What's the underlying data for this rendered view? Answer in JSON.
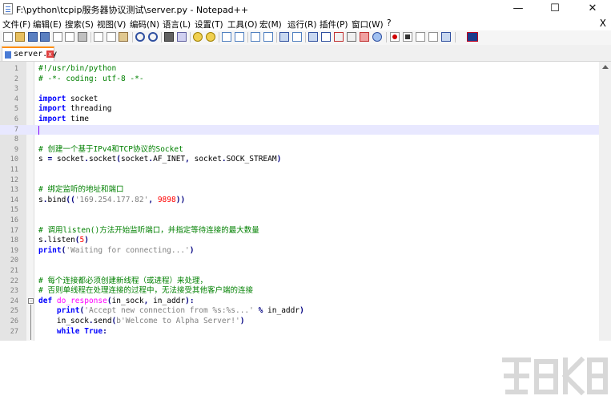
{
  "window": {
    "title": "F:\\python\\tcpip服务器协议测试\\server.py - Notepad++",
    "minimize_glyph": "—",
    "maximize_glyph": "☐",
    "close_glyph": "✕"
  },
  "menu": {
    "items": [
      "文件(F)",
      "编辑(E)",
      "搜索(S)",
      "视图(V)",
      "编码(N)",
      "语言(L)",
      "设置(T)",
      "工具(O)",
      "宏(M)",
      "运行(R)",
      "插件(P)",
      "窗口(W)",
      "?"
    ],
    "close_label": "X"
  },
  "tabs": [
    {
      "label": "server.py",
      "close_glyph": "x"
    }
  ],
  "editor": {
    "current_line": 7,
    "lines": [
      {
        "n": "1",
        "text": "#!/usr/bin/python"
      },
      {
        "n": "2",
        "text": "# -*- coding: utf-8 -*-"
      },
      {
        "n": "3",
        "text": ""
      },
      {
        "n": "4",
        "text": "import socket"
      },
      {
        "n": "5",
        "text": "import threading"
      },
      {
        "n": "6",
        "text": "import time"
      },
      {
        "n": "7",
        "text": ""
      },
      {
        "n": "8",
        "text": ""
      },
      {
        "n": "9",
        "text": "# 创建一个基于IPv4和TCP协议的Socket"
      },
      {
        "n": "10",
        "text": "s = socket.socket(socket.AF_INET, socket.SOCK_STREAM)"
      },
      {
        "n": "11",
        "text": ""
      },
      {
        "n": "12",
        "text": ""
      },
      {
        "n": "13",
        "text": "# 绑定监听的地址和端口"
      },
      {
        "n": "14",
        "text": "s.bind(('169.254.177.82', 9898))"
      },
      {
        "n": "15",
        "text": ""
      },
      {
        "n": "16",
        "text": ""
      },
      {
        "n": "17",
        "text": "# 调用listen()方法开始监听端口，并指定等待连接的最大数量"
      },
      {
        "n": "18",
        "text": "s.listen(5)"
      },
      {
        "n": "19",
        "text": "print('Waiting for connecting...')"
      },
      {
        "n": "20",
        "text": ""
      },
      {
        "n": "21",
        "text": ""
      },
      {
        "n": "22",
        "text": "# 每个连接都必须创建新线程（或进程）来处理，"
      },
      {
        "n": "23",
        "text": "# 否则单线程在处理连接的过程中，无法接受其他客户端的连接"
      },
      {
        "n": "24",
        "text": "def do_response(in_sock, in_addr):"
      },
      {
        "n": "25",
        "text": "    print('Accept new connection from %s:%s...' % in_addr)"
      },
      {
        "n": "26",
        "text": "    in_sock.send(b'Welcome to Alpha Server!')"
      },
      {
        "n": "27",
        "text": "    while True:"
      }
    ]
  },
  "colors": {
    "comment": "#008000",
    "keyword": "#0000ff",
    "string": "#808080",
    "number": "#ff0000",
    "function_name": "#ff00ff",
    "current_line_bg": "#e8e8ff",
    "tab_accent": "#ff8c00"
  },
  "toolbar_icons": [
    "new-file-icon",
    "open-file-icon",
    "save-icon",
    "save-all-icon",
    "close-icon",
    "close-all-icon",
    "print-icon",
    "cut-icon",
    "copy-icon",
    "paste-icon",
    "undo-icon",
    "redo-icon",
    "find-icon",
    "replace-icon",
    "zoom-in-icon",
    "zoom-out-icon",
    "sync-v-icon",
    "sync-h-icon",
    "wrap-icon",
    "all-chars-icon",
    "indent-guide-icon",
    "udl-icon",
    "doc-map-icon",
    "function-list-icon",
    "folder-workspace-icon",
    "monitor-icon",
    "record-macro-icon",
    "stop-macro-icon",
    "play-macro-icon",
    "play-multiple-icon",
    "save-macro-icon",
    "language-flag-icon"
  ]
}
